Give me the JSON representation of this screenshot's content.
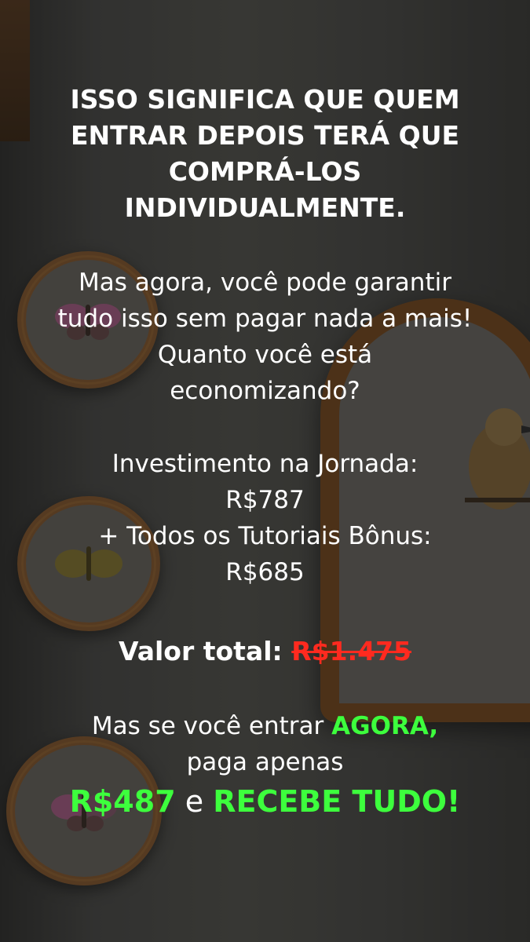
{
  "headline": [
    "ISSO SIGNIFICA QUE QUEM",
    "ENTRAR DEPOIS TERÁ QUE",
    "COMPRÁ-LOS",
    "INDIVIDUALMENTE."
  ],
  "intro": [
    "Mas agora, você pode garantir",
    "tudo isso sem pagar nada a mais!",
    "Quanto você está",
    "economizando?"
  ],
  "investment": [
    "Investimento na Jornada:",
    "R$787",
    "+ Todos os Tutoriais Bônus:",
    "R$685"
  ],
  "total": {
    "label": "Valor total:",
    "old_price": "R$1.475"
  },
  "offer": {
    "line1_prefix": "Mas se você entrar",
    "line1_highlight": "AGORA,",
    "line2": "paga apenas",
    "price": "R$487",
    "connector": "e",
    "cta": "RECEBE TUDO!"
  },
  "colors": {
    "highlight": "#3dff3d",
    "strike": "#ff2a1f",
    "text": "#ffffff"
  }
}
